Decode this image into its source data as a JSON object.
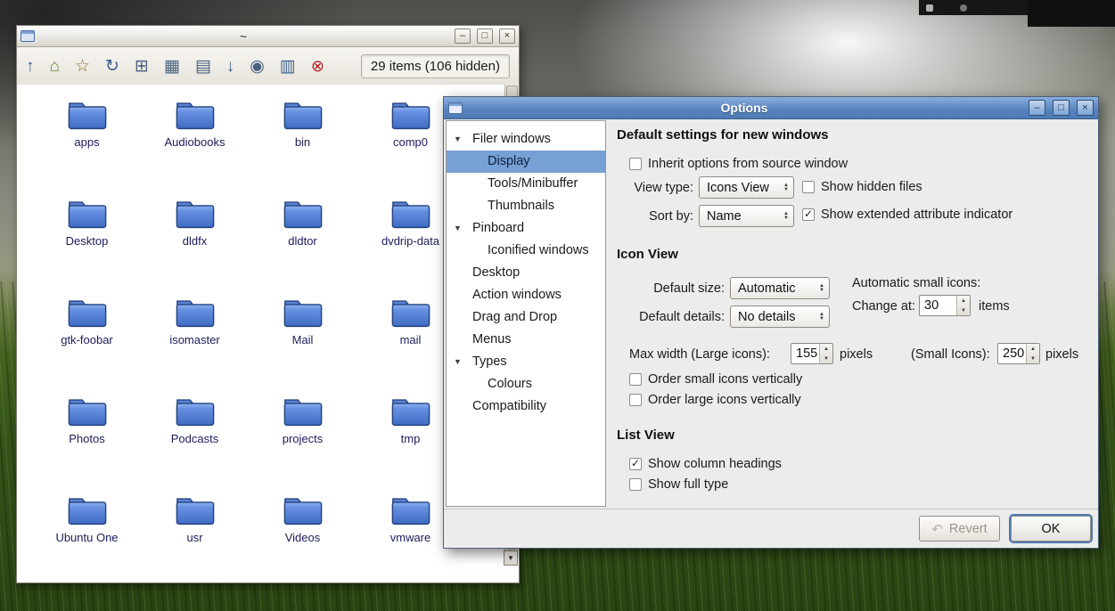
{
  "colors": {
    "dialog_titlebar_blue": "#5a86c0",
    "tree_selection_blue": "#77a0d4",
    "folder_blue": "#4a78cc",
    "ok_focus_ring": "#4d7ab4",
    "status_red": "#b22222"
  },
  "filer": {
    "title": "~",
    "controls": {
      "minimize": "–",
      "maximize": "□",
      "close": "×"
    },
    "toolbar": [
      {
        "name": "up-icon",
        "glyph": "↑"
      },
      {
        "name": "home-icon",
        "glyph": "⌂"
      },
      {
        "name": "bookmarks-icon",
        "glyph": "☆"
      },
      {
        "name": "refresh-icon",
        "glyph": "↻"
      },
      {
        "name": "new-window-icon",
        "glyph": "⊞"
      },
      {
        "name": "icons-view-icon",
        "glyph": "▦"
      },
      {
        "name": "list-view-icon",
        "glyph": "▤"
      },
      {
        "name": "sort-icon",
        "glyph": "↓"
      },
      {
        "name": "show-hidden-icon",
        "glyph": "◉"
      },
      {
        "name": "details-icon",
        "glyph": "▥"
      },
      {
        "name": "select-icon",
        "glyph": "⊗"
      }
    ],
    "status": "29 items (106 hidden)",
    "scroll_down_icon": "▼",
    "folders": [
      "apps",
      "Audiobooks",
      "bin",
      "comp0",
      "Desktop",
      "dldfx",
      "dldtor",
      "dvdrip-data",
      "gtk-foobar",
      "isomaster",
      "Mail",
      "mail",
      "Photos",
      "Podcasts",
      "projects",
      "tmp",
      "Ubuntu One",
      "usr",
      "Videos",
      "vmware"
    ]
  },
  "dialog": {
    "title": "Options",
    "controls": {
      "minimize": "–",
      "maximize": "□",
      "close": "×"
    },
    "tree": [
      {
        "label": "Filer windows"
      },
      {
        "label": "Display"
      },
      {
        "label": "Tools/Minibuffer"
      },
      {
        "label": "Thumbnails"
      },
      {
        "label": "Pinboard"
      },
      {
        "label": "Iconified windows"
      },
      {
        "label": "Desktop"
      },
      {
        "label": "Action windows"
      },
      {
        "label": "Drag and Drop"
      },
      {
        "label": "Menus"
      },
      {
        "label": "Types"
      },
      {
        "label": "Colours"
      },
      {
        "label": "Compatibility"
      }
    ],
    "new_windows": {
      "heading": "Default settings for new windows",
      "inherit_label": "Inherit options from source window",
      "view_type_label": "View type:",
      "view_type_value": "Icons View",
      "show_hidden_label": "Show hidden files",
      "sort_by_label": "Sort by:",
      "sort_by_value": "Name",
      "extended_attr_label": "Show extended attribute indicator"
    },
    "icon_view": {
      "heading": "Icon View",
      "default_size_label": "Default size:",
      "default_size_value": "Automatic",
      "auto_small_label": "Automatic small icons:",
      "change_at_label": "Change at:",
      "change_at_value": "30",
      "items_label": "items",
      "default_details_label": "Default details:",
      "default_details_value": "No details",
      "max_width_label": "Max width (Large icons):",
      "max_width_value": "155",
      "pixels_label": "pixels",
      "small_icons_label": "(Small Icons):",
      "small_icons_value": "250",
      "pixels2_label": "pixels",
      "order_small_label": "Order small icons vertically",
      "order_large_label": "Order large icons vertically"
    },
    "list_view": {
      "heading": "List View",
      "column_headings_label": "Show column headings",
      "full_type_label": "Show full type"
    },
    "checks": {
      "inherit": false,
      "show_hidden": false,
      "extended_attr": true,
      "order_small": false,
      "order_large": false,
      "column_headings": true,
      "full_type": false
    },
    "buttons": {
      "revert": "Revert",
      "ok": "OK"
    }
  }
}
